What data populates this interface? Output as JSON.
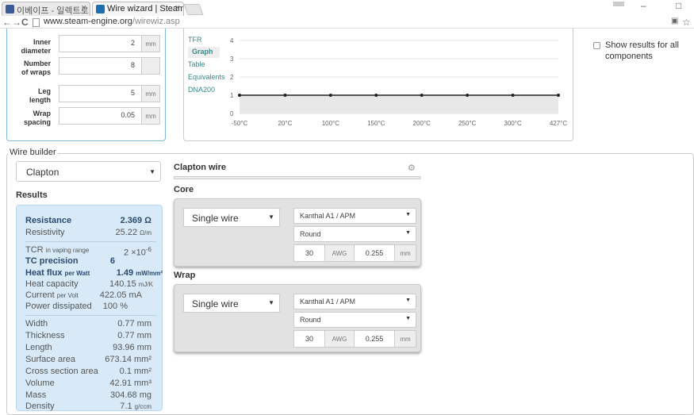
{
  "browser": {
    "tab1_title": "이베이프 - 일렉트로",
    "tab2_title": "Wire wizard | Steam",
    "url_host": "www.steam-engine.org",
    "url_path": "/wirewiz.asp"
  },
  "inputs": [
    {
      "label_line1": "Inner",
      "label_line2": "diameter",
      "value": "2",
      "unit": "mm"
    },
    {
      "label_line1": "Number",
      "label_line2": "of wraps",
      "value": "8",
      "unit": ""
    },
    {
      "label_line1": "Leg",
      "label_line2": "length",
      "value": "5",
      "unit": "mm"
    },
    {
      "label_line1": "Wrap",
      "label_line2": "spacing",
      "value": "0.05",
      "unit": "mm"
    }
  ],
  "graph_tabs": [
    "TFR",
    "Graph",
    "Table",
    "Equivalents",
    "DNA200"
  ],
  "show_all_label": "Show results for all components",
  "chart_data": {
    "type": "line",
    "categories": [
      "-50°C",
      "20°C",
      "100°C",
      "150°C",
      "200°C",
      "250°C",
      "300°C",
      "427°C"
    ],
    "values": [
      1,
      1,
      1,
      1,
      1,
      1,
      1,
      1
    ],
    "yticks": [
      "0",
      "1",
      "2",
      "3",
      "4"
    ],
    "ylim": [
      0,
      4
    ]
  },
  "builder": {
    "legend": "Wire builder",
    "wire_type": "Clapton",
    "results_title": "Results",
    "section_title": "Clapton wire",
    "core_title": "Core",
    "wrap_title": "Wrap"
  },
  "results": {
    "resistance_label": "Resistance",
    "resistance_value": "2.369 Ω",
    "resistivity_label": "Resistivity",
    "resistivity_value": "25.22",
    "resistivity_unit": "Ω/m",
    "tcr_label": "TCR",
    "tcr_sub": "in vaping range",
    "tcr_value": "2 ×10",
    "tcr_exp": "-6",
    "tcp_label": "TC precision",
    "tcp_value": "6",
    "heatflux_label": "Heat flux",
    "heatflux_sub": "per Watt",
    "heatflux_value": "1.49",
    "heatflux_unit": "mW/mm²",
    "heatcap_label": "Heat capacity",
    "heatcap_value": "140.15",
    "heatcap_unit": "mJ/K",
    "current_label": "Current",
    "current_sub": "per Volt",
    "current_value": "422.05 mA",
    "power_label": "Power dissipated",
    "power_value": "100 %",
    "width_label": "Width",
    "width_value": "0.77 mm",
    "thickness_label": "Thickness",
    "thickness_value": "0.77 mm",
    "length_label": "Length",
    "length_value": "93.96 mm",
    "surface_label": "Surface area",
    "surface_value": "673.14 mm²",
    "cross_label": "Cross section area",
    "cross_value": "0.1 mm²",
    "volume_label": "Volume",
    "volume_value": "42.91 mm³",
    "mass_label": "Mass",
    "mass_value": "304.68 mg",
    "density_label": "Density",
    "density_value": "7.1",
    "density_unit": "g/ccm"
  },
  "core": {
    "type": "Single wire",
    "material": "Kanthal A1 / APM",
    "shape": "Round",
    "awg": "30",
    "awg_label": "AWG",
    "mm": "0.255",
    "mm_unit": "mm"
  },
  "wrap": {
    "type": "Single wire",
    "material": "Kanthal A1 / APM",
    "shape": "Round",
    "awg": "30",
    "awg_label": "AWG",
    "mm": "0.255",
    "mm_unit": "mm"
  }
}
